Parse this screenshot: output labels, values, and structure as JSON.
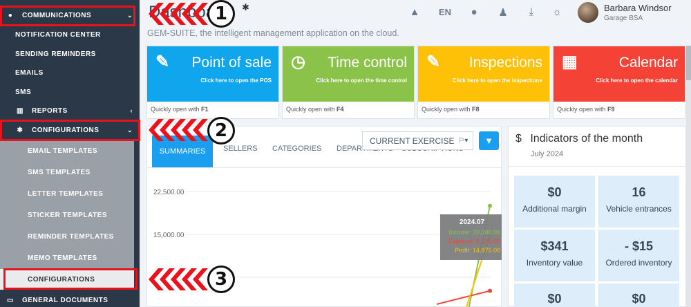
{
  "sidebar": {
    "items": [
      {
        "label": "COMMUNICATIONS",
        "icon": "comment-icon"
      },
      {
        "label": "NOTIFICATION CENTER"
      },
      {
        "label": "SENDING REMINDERS"
      },
      {
        "label": "EMAILS"
      },
      {
        "label": "SMS"
      },
      {
        "label": "REPORTS",
        "icon": "bar-chart-icon"
      },
      {
        "label": "CONFIGURATIONS",
        "icon": "gear-icon"
      },
      {
        "label": "EMAIL TEMPLATES"
      },
      {
        "label": "SMS TEMPLATES"
      },
      {
        "label": "LETTER TEMPLATES"
      },
      {
        "label": "STICKER TEMPLATES"
      },
      {
        "label": "REMINDER TEMPLATES"
      },
      {
        "label": "MEMO TEMPLATES"
      },
      {
        "label": "CONFIGURATIONS"
      },
      {
        "label": "GENERAL DOCUMENTS",
        "icon": "folder-icon"
      }
    ]
  },
  "header": {
    "title": "Dashboard",
    "subtitle": "GEM-SUITE, the intelligent management application on the cloud.",
    "lang": "EN",
    "user": {
      "name": "Barbara Windsor",
      "company": "Garage BSA"
    }
  },
  "tiles": [
    {
      "name": "Point of sale",
      "link": "Click here to open the POS",
      "foot_text": "Quickly open with ",
      "foot_key": "F1",
      "color": "#10a6ee",
      "icon": "edit-icon"
    },
    {
      "name": "Time control",
      "link": "Click here to open the time control",
      "foot_text": "Quickly open with ",
      "foot_key": "F4",
      "color": "#8bc34a",
      "icon": "clock-icon"
    },
    {
      "name": "Inspections",
      "link": "Click here to open the inspections",
      "foot_text": "Quickly open with ",
      "foot_key": "F8",
      "color": "#ffc107",
      "icon": "edit-icon"
    },
    {
      "name": "Calendar",
      "link": "Click here to open the calendar",
      "foot_text": "Quickly open with ",
      "foot_key": "F9",
      "color": "#f44336",
      "icon": "calendar-icon"
    }
  ],
  "tabs": [
    "SUMMARIES",
    "SELLERS",
    "CATEGORIES",
    "DEPARTMENTS",
    "SUBSCRIPTIONS"
  ],
  "exercise_select": "CURRENT EXERCISE",
  "chart_data": {
    "type": "line",
    "y_ticks": [
      "22,500.00",
      "15,000.00"
    ],
    "tooltip": {
      "title": "2024.07",
      "rows": [
        {
          "label": "Income: 20,000.00",
          "color": "#8bc34a"
        },
        {
          "label": "Expense: 5,125.00",
          "color": "#f44336"
        },
        {
          "label": "Profit: 14,875.00",
          "color": "#ffc107"
        }
      ]
    },
    "series": [
      {
        "values": [
          20000
        ],
        "color": "#8bc34a"
      },
      {
        "values": [
          5125
        ],
        "color": "#f44336"
      },
      {
        "values": [
          14875
        ],
        "color": "#ffc107"
      }
    ]
  },
  "indicators": {
    "title": "Indicators of the month",
    "currency_icon": "$",
    "period": "July 2024",
    "cards": [
      {
        "value": "$0",
        "label": "Additional margin"
      },
      {
        "value": "16",
        "label": "Vehicle entrances"
      },
      {
        "value": "$341",
        "label": "Inventory value"
      },
      {
        "value": "- $15",
        "label": "Ordered inventory"
      },
      {
        "value": "$0",
        "label": ""
      },
      {
        "value": "$0",
        "label": ""
      }
    ]
  },
  "annotations": [
    "1",
    "2",
    "3"
  ]
}
